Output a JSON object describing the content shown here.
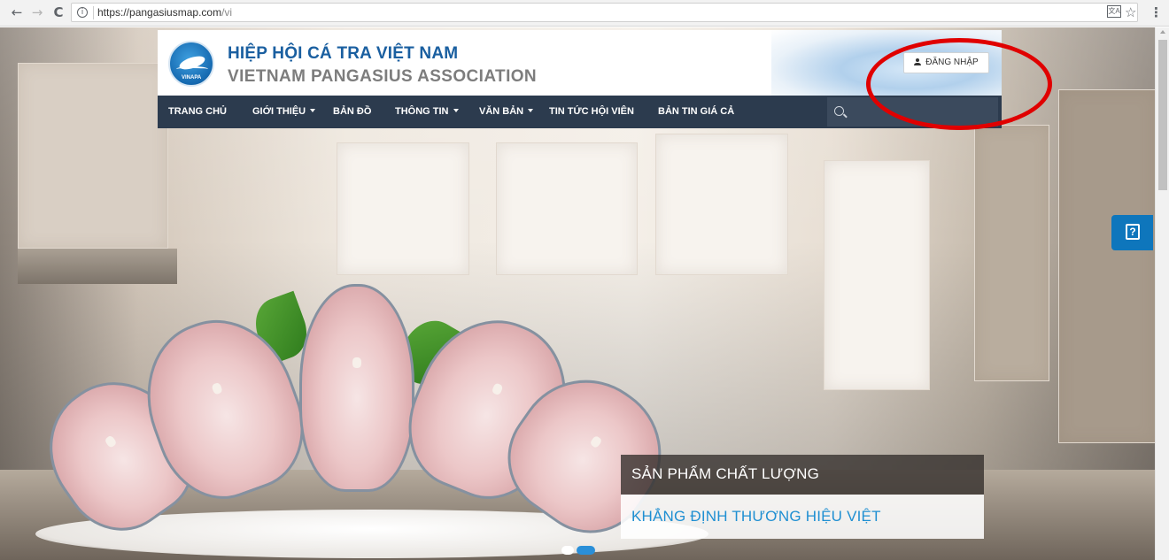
{
  "browser": {
    "url_host": "https://pangasiusmap.com",
    "url_path": "/vi",
    "icons": [
      "back-icon",
      "forward-icon",
      "reload-icon",
      "info-icon",
      "translate-icon",
      "star-icon",
      "menu-icon"
    ]
  },
  "header": {
    "title_vi": "HIỆP HỘI CÁ TRA VIỆT NAM",
    "title_en": "VIETNAM PANGASIUS ASSOCIATION",
    "logo_text": "VINAPA",
    "login_label": "ĐĂNG NHẬP"
  },
  "nav": {
    "items": [
      {
        "label": "TRANG CHỦ",
        "has_caret": false
      },
      {
        "label": "GIỚI THIỆU",
        "has_caret": true
      },
      {
        "label": "BẢN ĐỒ",
        "has_caret": false
      },
      {
        "label": "THÔNG TIN",
        "has_caret": true
      },
      {
        "label": "VĂN BẢN",
        "has_caret": true
      },
      {
        "label": "TIN TỨC HỘI VIÊN",
        "has_caret": false
      },
      {
        "label": "BẢN TIN GIÁ CẢ",
        "has_caret": false
      }
    ],
    "search_placeholder": ""
  },
  "slider": {
    "caption_title": "SẢN PHẨM CHẤT LƯỢNG",
    "caption_subtitle": "KHẲNG ĐỊNH THƯƠNG HIỆU VIỆT",
    "active_slide": 2,
    "slide_count": 2
  },
  "help": {
    "icon": "help-icon",
    "symbol": "?"
  },
  "colors": {
    "nav_bg": "#2c3b4e",
    "brand_blue": "#1a5fa0",
    "caption_blue": "#1f8fd2",
    "help_blue": "#0e76bc",
    "highlight_red": "#e00000"
  }
}
